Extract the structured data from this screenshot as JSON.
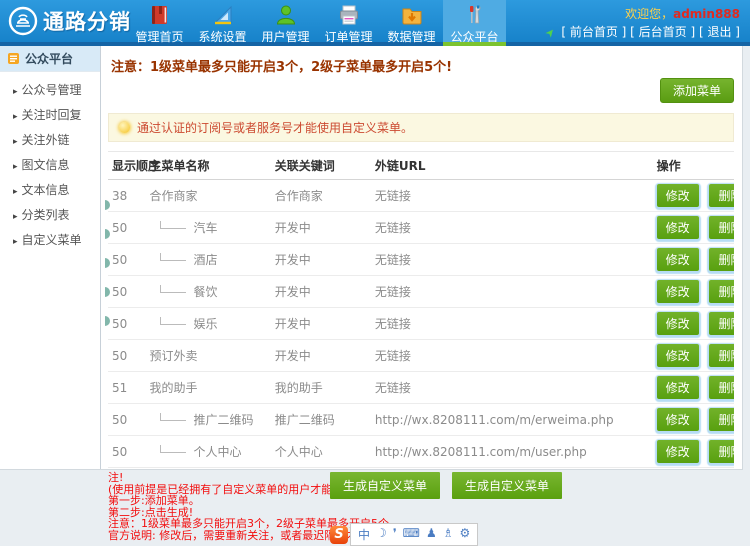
{
  "header": {
    "logo_text": "通路分销",
    "welcome_prefix": "欢迎您，",
    "username": "admin888",
    "links": [
      "[ 前台首页 ]",
      "[ 后台首页 ]",
      "[ 退出 ]"
    ],
    "nav": [
      {
        "label": "管理首页",
        "icon": "book-icon",
        "active": false
      },
      {
        "label": "系统设置",
        "icon": "set-square-icon",
        "active": false
      },
      {
        "label": "用户管理",
        "icon": "user-icon",
        "active": false
      },
      {
        "label": "订单管理",
        "icon": "printer-icon",
        "active": false
      },
      {
        "label": "数据管理",
        "icon": "folder-icon",
        "active": false
      },
      {
        "label": "公众平台",
        "icon": "tools-icon",
        "active": true
      }
    ]
  },
  "sidebar": {
    "title": "公众平台",
    "items": [
      "公众号管理",
      "关注时回复",
      "关注外链",
      "图文信息",
      "文本信息",
      "分类列表",
      "自定义菜单"
    ]
  },
  "main": {
    "notice": "注意：1级菜单最多只能开启3个，2级子菜单最多开启5个!",
    "add_button": "添加菜单",
    "tip": "通过认证的订阅号或者服务号才能使用自定义菜单。",
    "table": {
      "headers": [
        "显示顺序",
        "主菜单名称",
        "关联关键词",
        "外链URL",
        "操作"
      ],
      "actions": [
        "修改",
        "删除"
      ],
      "rows": [
        {
          "order": "38",
          "name": "合作商家",
          "sub": false,
          "keyword": "合作商家",
          "url": "无链接"
        },
        {
          "order": "50",
          "name": "汽车",
          "sub": true,
          "keyword": "开发中",
          "url": "无链接"
        },
        {
          "order": "50",
          "name": "酒店",
          "sub": true,
          "keyword": "开发中",
          "url": "无链接"
        },
        {
          "order": "50",
          "name": "餐饮",
          "sub": true,
          "keyword": "开发中",
          "url": "无链接"
        },
        {
          "order": "50",
          "name": "娱乐",
          "sub": true,
          "keyword": "开发中",
          "url": "无链接"
        },
        {
          "order": "50",
          "name": "预订外卖",
          "sub": false,
          "keyword": "开发中",
          "url": "无链接"
        },
        {
          "order": "51",
          "name": "我的助手",
          "sub": false,
          "keyword": "我的助手",
          "url": "无链接"
        },
        {
          "order": "50",
          "name": "推广二维码",
          "sub": true,
          "keyword": "推广二维码",
          "url": "http://wx.8208111.com/m/erweima.php"
        },
        {
          "order": "50",
          "name": "个人中心",
          "sub": true,
          "keyword": "个人中心",
          "url": "http://wx.8208111.com/m/user.php"
        }
      ]
    },
    "notes": [
      "注!",
      "(使用前提是已经拥有了自定义菜单的用户才能够使用。)",
      "第一步:添加菜单。",
      "第二步:点击生成!",
      "注意：1级菜单最多只能开启3个，2级子菜单最多开启5个",
      "官方说明: 修改后，需要重新关注，或者最迟隔天才会看到修改后的效果!"
    ],
    "generate_buttons": [
      "生成自定义菜单",
      "生成自定义菜单"
    ]
  },
  "sogou_toolbar": {
    "logo": "S",
    "icons": [
      "chinese-mode-icon",
      "half-moon-icon",
      "punctuation-icon",
      "soft-keyboard-icon",
      "person-icon",
      "skin-icon",
      "wrench-icon"
    ]
  },
  "colors": {
    "header_blue": "#1f87cd",
    "active_tab_blue": "#4fabe3",
    "tab_underline_green": "#7cc32f",
    "accent_green": "#63a713",
    "notice_dark_red": "#993300",
    "tip_red": "#cc4a31",
    "note_red": "#f20d0d",
    "username_red": "#e02a20",
    "welcome_yellow": "#ffd24a"
  }
}
